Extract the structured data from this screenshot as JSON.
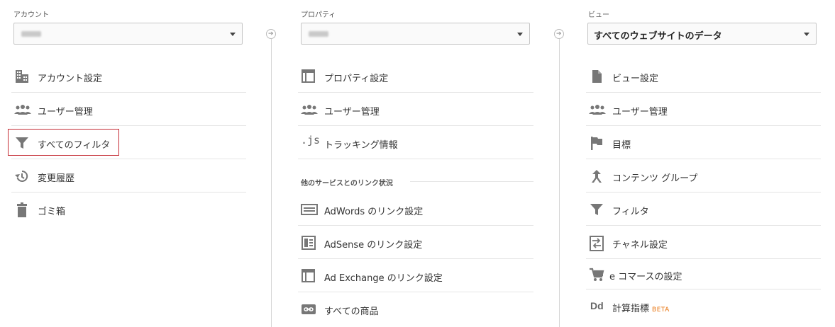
{
  "account": {
    "label": "アカウント",
    "items": [
      {
        "label": "アカウント設定"
      },
      {
        "label": "ユーザー管理"
      },
      {
        "label": "すべてのフィルタ"
      },
      {
        "label": "変更履歴"
      },
      {
        "label": "ゴミ箱"
      }
    ]
  },
  "property": {
    "label": "プロパティ",
    "items": [
      {
        "label": "プロパティ設定"
      },
      {
        "label": "ユーザー管理"
      },
      {
        "label": "トラッキング情報"
      }
    ],
    "section_title": "他のサービスとのリンク状況",
    "link_items": [
      {
        "label": "AdWords のリンク設定"
      },
      {
        "label": "AdSense のリンク設定"
      },
      {
        "label": "Ad Exchange のリンク設定"
      },
      {
        "label": "すべての商品"
      }
    ]
  },
  "view": {
    "label": "ビュー",
    "selected": "すべてのウェブサイトのデータ",
    "items": [
      {
        "label": "ビュー設定"
      },
      {
        "label": "ユーザー管理"
      },
      {
        "label": "目標"
      },
      {
        "label": "コンテンツ グループ"
      },
      {
        "label": "フィルタ"
      },
      {
        "label": "チャネル設定"
      },
      {
        "label": "e コマースの設定"
      },
      {
        "label": "計算指標",
        "badge": "BETA"
      }
    ]
  },
  "icons": {
    "js": ".js",
    "dd": "Dd",
    "arrow": "➔"
  }
}
